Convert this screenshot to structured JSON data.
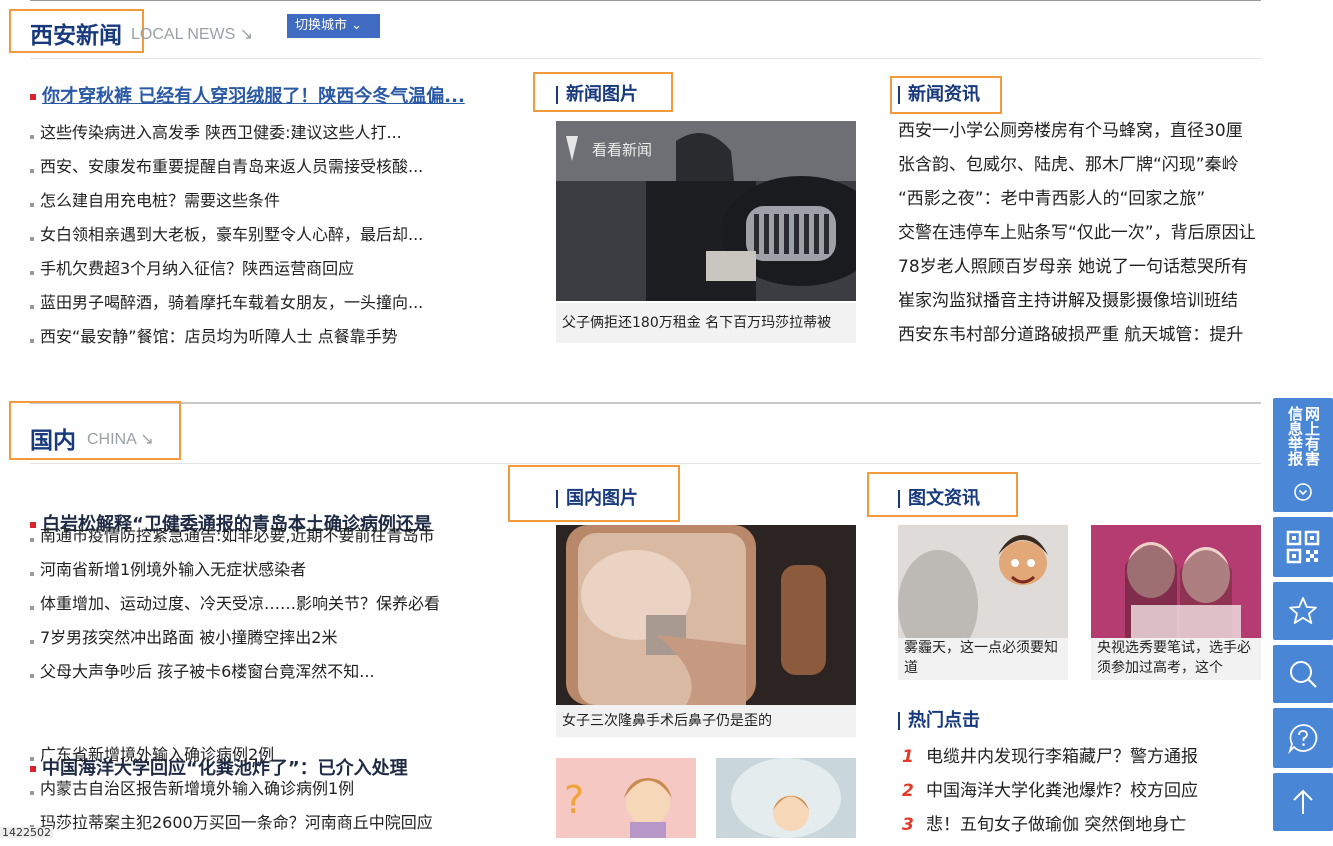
{
  "local": {
    "title": "西安新闻",
    "subtitle": "LOCAL NEWS ↘",
    "switch_label": "切换城市 ⌄",
    "headline": "你才穿秋裤 已经有人穿羽绒服了！陕西今冬气温偏...",
    "items": [
      "这些传染病进入高发季 陕西卫健委:建议这些人打...",
      "西安、安康发布重要提醒自青岛来返人员需接受核酸...",
      "怎么建自用充电桩？需要这些条件",
      "女白领相亲遇到大老板，豪车别墅令人心醉，最后却...",
      "手机欠费超3个月纳入征信？陕西运营商回应",
      "蓝田男子喝醉酒，骑着摩托车载着女朋友，一头撞向...",
      "西安“最安静”餐馆：店员均为听障人士 点餐靠手势"
    ],
    "photo_title": "新闻图片",
    "photo_watermark": "看看新闻",
    "photo_caption": "父子俩拒还180万租金  名下百万玛莎拉蒂被",
    "info_title": "新闻资讯",
    "info_items": [
      "西安一小学公厕旁楼房有个马蜂窝，直径30厘",
      "张含韵、包威尔、陆虎、那木厂牌“闪现”秦岭",
      "“西影之夜”：老中青西影人的“回家之旅”",
      "交警在违停车上贴条写“仅此一次”，背后原因让",
      "78岁老人照顾百岁母亲 她说了一句话惹哭所有",
      "崔家沟监狱播音主持讲解及摄影摄像培训班结",
      "西安东韦村部分道路破损严重 航天城管：提升"
    ]
  },
  "china": {
    "title": "国内",
    "subtitle": "CHINA ↘",
    "headline1": "白岩松解释“卫健委通报的青岛本土确诊病例还是",
    "items1": [
      "南通市疫情防控紧急通告:如非必要,近期不要前往青岛市",
      "河南省新增1例境外输入无症状感染者",
      "体重增加、运动过度、冷天受凉……影响关节？保养必看",
      "7岁男孩突然冲出路面 被小撞腾空摔出2米",
      "父母大声争吵后 孩子被卡6楼窗台竟浑然不知..."
    ],
    "headline2": "中国海洋大学回应“化粪池炸了”：已介入处理",
    "items2": [
      "广东省新增境外输入确诊病例2例",
      "内蒙古自治区报告新增境外输入确诊病例1例",
      "玛莎拉蒂案主犯2600万买回一条命？河南商丘中院回应"
    ],
    "photo_title": "国内图片",
    "photo_caption": "女子三次隆鼻手术后鼻子仍是歪的",
    "pic_info_title": "图文资讯",
    "pic_cards": [
      {
        "caption": "雾霾天，这一点必须要知道"
      },
      {
        "caption": "央视选秀要笔试，选手必须参加过高考，这个"
      }
    ],
    "hot_title": "热门点击",
    "hot_items": [
      {
        "num": "1",
        "text": "电缆井内发现行李箱藏尸？警方通报"
      },
      {
        "num": "2",
        "text": "中国海洋大学化粪池爆炸？校方回应"
      },
      {
        "num": "3",
        "text": "悲！五旬女子做瑜伽 突然倒地身亡"
      }
    ]
  },
  "sidebar": {
    "report_label": "网上有害信息举报"
  },
  "footer_counter": "1422502",
  "colors": {
    "accent": "#183a7d",
    "brand_blue": "#4a86d6",
    "highlight_box": "#f39a3d",
    "hot_red": "#e2392b"
  }
}
